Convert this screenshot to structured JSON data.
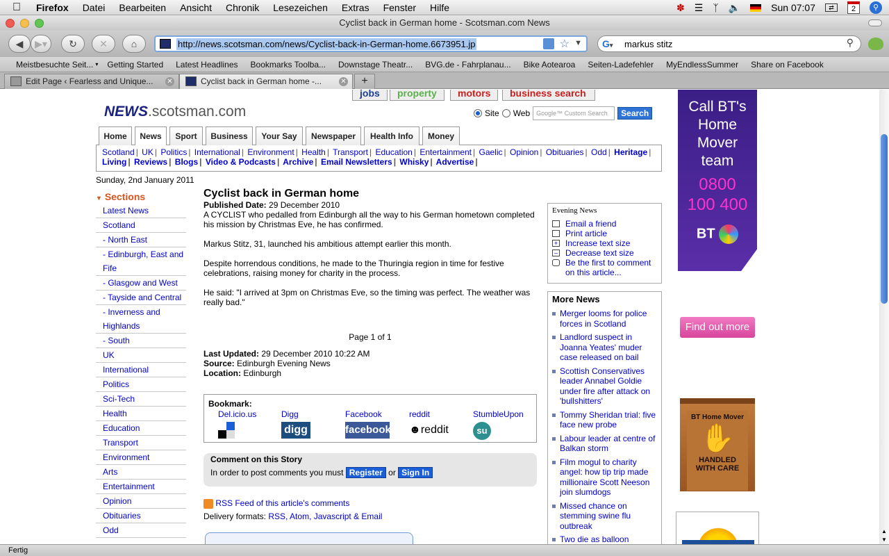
{
  "menubar": {
    "app": "Firefox",
    "items": [
      "Datei",
      "Bearbeiten",
      "Ansicht",
      "Chronik",
      "Lesezeichen",
      "Extras",
      "Fenster",
      "Hilfe"
    ],
    "clock": "Sun 07:07",
    "calendar_day": "2"
  },
  "window": {
    "title": "Cyclist back in German home - Scotsman.com News"
  },
  "navbar": {
    "url": "http://news.scotsman.com/news/Cyclist-back-in-German-home.6673951.jp",
    "search_value": "markus stitz"
  },
  "bookmarks": [
    "Meistbesuchte Seit...",
    "Getting Started",
    "Latest Headlines",
    "Bookmarks Toolba...",
    "Downstage Theatr...",
    "BVG.de - Fahrplanau...",
    "Bike Aotearoa",
    "Seiten-Ladefehler",
    "MyEndlessSummer",
    "Share on Facebook"
  ],
  "tabs": [
    {
      "label": "Edit Page ‹ Fearless and Unique..."
    },
    {
      "label": "Cyclist back in German home -..."
    }
  ],
  "status": "Fertig",
  "site": {
    "top_tabs": [
      "jobs",
      "property",
      "motors",
      "business search"
    ],
    "logo_news": "NEWS",
    "logo_domain": ".scotsman.com",
    "search_site": "Site",
    "search_web": "Web",
    "search_placeholder": "Google™ Custom Search",
    "search_button": "Search",
    "nav_tabs": [
      "Home",
      "News",
      "Sport",
      "Business",
      "Your Say",
      "Newspaper",
      "Health Info",
      "Money"
    ],
    "subnav_row1": [
      "Scotland",
      "UK",
      "Politics",
      "International",
      "Environment",
      "Health",
      "Transport",
      "Education",
      "Entertainment",
      "Gaelic",
      "Opinion",
      "Obituaries",
      "Odd",
      "Heritage"
    ],
    "subnav_row2": [
      "Living",
      "Reviews",
      "Blogs",
      "Video & Podcasts",
      "Archive",
      "Email Newsletters",
      "Whisky",
      "Advertise"
    ],
    "date": "Sunday, 2nd January 2011"
  },
  "sidebar": {
    "heading": "Sections",
    "items": [
      "Latest News",
      "Scotland",
      "- North East",
      "- Edinburgh, East and",
      "Fife",
      "- Glasgow and West",
      "- Tayside and Central",
      "- Inverness and",
      "Highlands",
      "- South",
      "UK",
      "International",
      "Politics",
      "Sci-Tech",
      "Health",
      "Education",
      "Transport",
      "Environment",
      "Arts",
      "Entertainment",
      "Opinion",
      "Obituaries",
      "Odd"
    ]
  },
  "article": {
    "title": "Cyclist back in German home",
    "published_label": "Published Date:",
    "published": "29 December 2010",
    "paragraphs": [
      "A CYCLIST who pedalled from Edinburgh all the way to his German hometown completed his mission by Christmas Eve, he has confirmed.",
      "Markus Stitz, 31, launched his ambitious attempt earlier this month.",
      "Despite horrendous conditions, he made to the Thuringia region in time for festive celebrations, raising money for charity in the process.",
      "He said: \"I arrived at 3pm on Christmas Eve, so the timing was perfect. The weather was really bad.\""
    ],
    "page_indicator": "Page 1 of 1",
    "updated_label": "Last Updated:",
    "updated": "29 December 2010 10:22 AM",
    "source_label": "Source:",
    "source": "Edinburgh Evening News",
    "location_label": "Location:",
    "location": "Edinburgh"
  },
  "bookmark_box": {
    "heading": "Bookmark:",
    "services": [
      "Del.icio.us",
      "Digg",
      "Facebook",
      "reddit",
      "StumbleUpon"
    ],
    "logos": [
      "digg",
      "facebook",
      "reddit"
    ]
  },
  "comments": {
    "heading": "Comment on this Story",
    "prompt": "In order to post comments you must",
    "register": "Register",
    "or": "or",
    "signin": "Sign In",
    "rss": "RSS Feed of this article's comments",
    "delivery_label": "Delivery formats:",
    "delivery_links": "RSS, Atom, Javascript & Email"
  },
  "tools": {
    "brand": "Evening News",
    "items": [
      "Email a friend",
      "Print article",
      "Increase text size",
      "Decrease text size",
      "Be the first to comment on this article..."
    ]
  },
  "more_news": {
    "heading": "More News",
    "items": [
      "Merger looms for police forces in Scotland",
      "Landlord suspect in Joanna Yeates' muder case released on bail",
      "Scottish Conservatives leader Annabel Goldie under fire after attack on 'bullshitters'",
      "Tommy Sheridan trial: five face new probe",
      "Labour leader at centre of Balkan storm",
      "Film mogul to charity angel: how tip trip made millionaire Scott Neeson join slumdogs",
      "Missed chance on stemming swine flu outbreak",
      "Two die as balloon"
    ]
  },
  "ads": {
    "bt_lines": [
      "Call BT's",
      "Home",
      "Mover",
      "team"
    ],
    "bt_phone": [
      "0800",
      "100 400"
    ],
    "bt_logo": "BT",
    "find_out": "Find out more",
    "box_title": "BT Home Mover",
    "box_caption": "HANDLED WITH CARE"
  }
}
